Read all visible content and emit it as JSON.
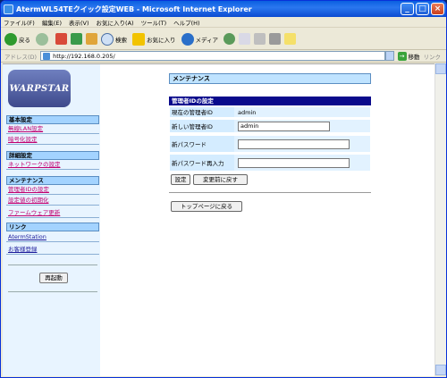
{
  "window": {
    "title": "AtermWL54TEクイック設定WEB - Microsoft Internet Explorer"
  },
  "menu": [
    "ファイル(F)",
    "編集(E)",
    "表示(V)",
    "お気に入り(A)",
    "ツール(T)",
    "ヘルプ(H)"
  ],
  "toolbar": {
    "back": "戻る",
    "search": "検索",
    "favorites": "お気に入り",
    "media": "メディア"
  },
  "address": {
    "label": "アドレス(D)",
    "url": "http://192.168.0.205/",
    "go": "移動",
    "links": "リンク"
  },
  "sidebar": {
    "logo": "WARPSTAR",
    "sections": [
      {
        "title": "基本設定",
        "links": [
          "無線LAN設定",
          "暗号化設定"
        ]
      },
      {
        "title": "詳細設定",
        "links": [
          "ネットワークの設定"
        ]
      },
      {
        "title": "メンテナンス",
        "links": [
          "管理者IDの設定",
          "設定値の初期化",
          "ファームウェア更新"
        ]
      },
      {
        "title": "リンク",
        "links": [
          "AtermStation",
          "お客様登録"
        ]
      }
    ],
    "restart": "再起動"
  },
  "main": {
    "page_title": "メンテナンス",
    "section_title": "管理者IDの設定",
    "current_id_label": "現在の管理者ID",
    "current_id_value": "admin",
    "new_id_label": "新しい管理者ID",
    "new_id_value": "admin",
    "new_pw_label": "新パスワード",
    "new_pw_value": "",
    "new_pw_confirm_label": "新パスワード再入力",
    "new_pw_confirm_value": "",
    "set_button": "設定",
    "revert_button": "変更前に戻す",
    "top_button": "トップページに戻る"
  }
}
